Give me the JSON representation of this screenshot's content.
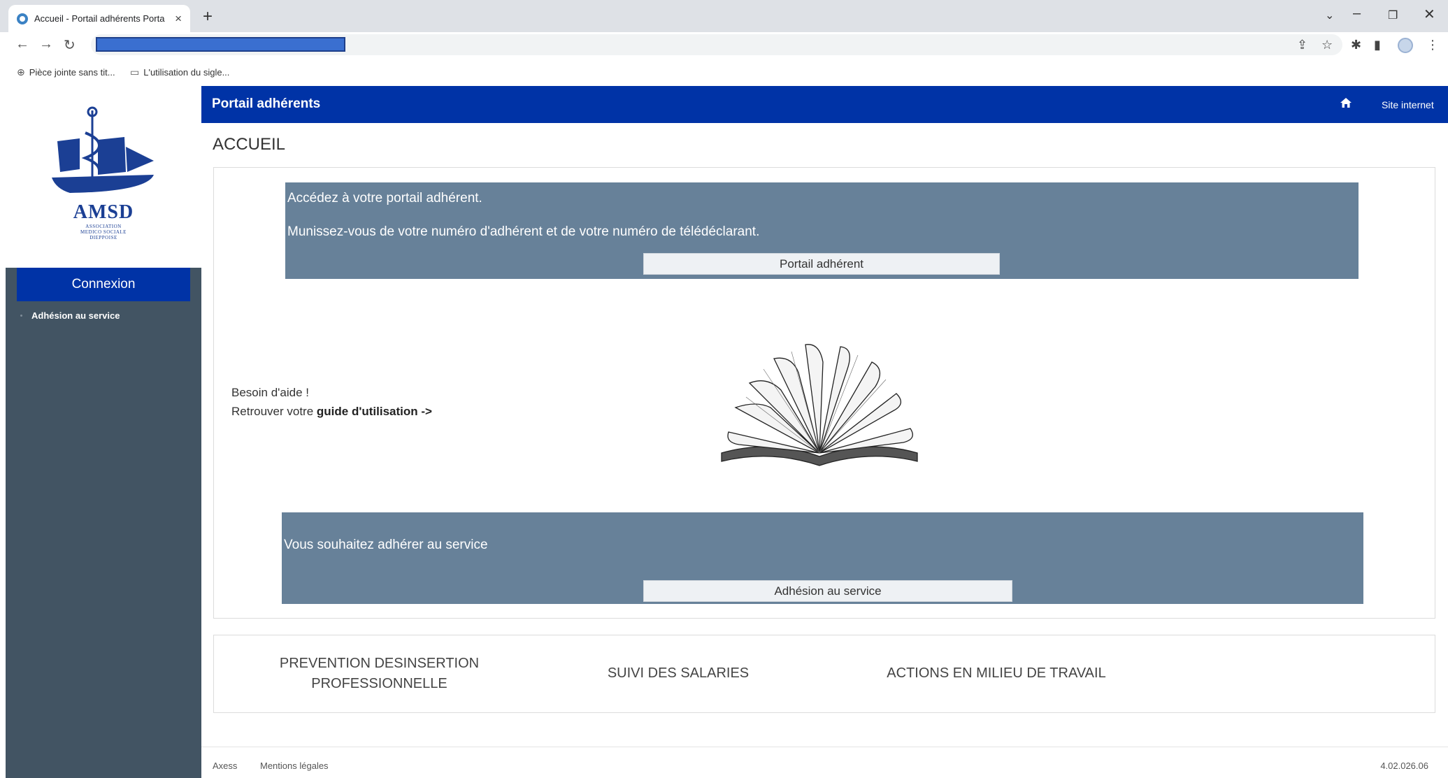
{
  "browser": {
    "tab_title": "Accueil - Portail adhérents Porta",
    "tab_close": "×",
    "new_tab": "+",
    "window_controls": [
      "⌄",
      "–",
      "❐",
      "✕"
    ],
    "bookmarks": [
      "Pièce jointe sans tit...",
      "L'utilisation du sigle..."
    ]
  },
  "sidebar": {
    "logo_text": "AMSD",
    "logo_sub": [
      "ASSOCIATION",
      "MEDICO SOCIALE",
      "DIEPPOISE"
    ],
    "connexion": "Connexion",
    "link": "Adhésion au service"
  },
  "header": {
    "brand": "Portail adhérents",
    "site_link": "Site internet"
  },
  "page_title": "ACCUEIL",
  "portal_panel": {
    "line1": "Accédez à votre portail adhérent.",
    "line2": "Munissez-vous de votre numéro d'adhérent et de votre numéro de télédéclarant.",
    "button": "Portail adhérent"
  },
  "help": {
    "line1": "Besoin d'aide !",
    "line2_prefix": "Retrouver votre ",
    "line2_link": "guide d'utilisation ->"
  },
  "join_panel": {
    "text": "Vous souhaitez adhérer au service",
    "button": "Adhésion au service"
  },
  "services": {
    "s1_line1": "PREVENTION DESINSERTION",
    "s1_line2": "PROFESSIONNELLE",
    "s2": "SUIVI DES SALARIES",
    "s3": "ACTIONS EN MILIEU DE TRAVAIL"
  },
  "footer": {
    "axess": "Axess",
    "legal": "Mentions légales",
    "version": "4.02.026.06"
  }
}
